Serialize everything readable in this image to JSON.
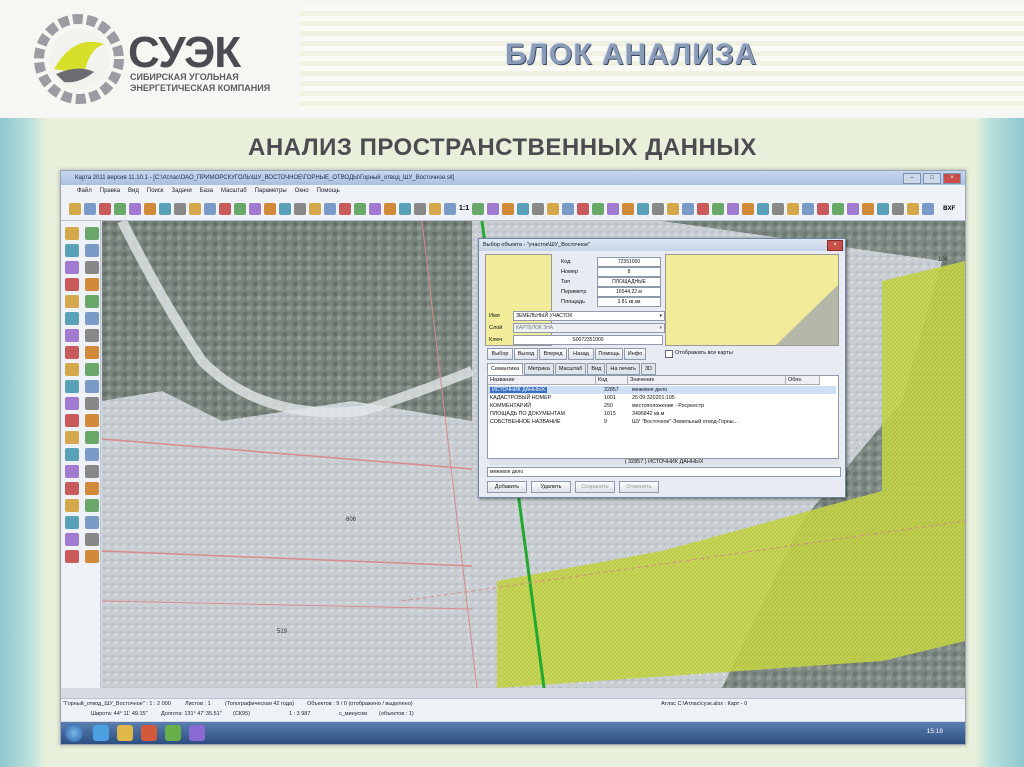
{
  "slide": {
    "logo_title": "СУЭК",
    "logo_subtitle_1": "СИБИРСКАЯ УГОЛЬНАЯ",
    "logo_subtitle_2": "ЭНЕРГЕТИЧЕСКАЯ КОМПАНИЯ",
    "block_title": "БЛОК АНАЛИЗА",
    "section_title": "АНАЛИЗ ПРОСТРАНСТВЕННЫХ ДАННЫХ"
  },
  "app": {
    "window_title": "Карта 2011 версия 11.10.1 - [C:\\Атлас\\ОАО_ПРИМОРСКУГОЛЬ\\ШУ_ВОСТОЧНОЕ\\ГОРНЫЕ_ОТВОДЫ\\Горный_отвод_ШУ_Восточное.sit]",
    "menu": [
      "Файл",
      "Правка",
      "Вид",
      "Поиск",
      "Задачи",
      "База",
      "Масштаб",
      "Параметры",
      "Окно",
      "Помощь"
    ],
    "zoom_label": "1:1",
    "toolbar_right_label": "BXF",
    "map_labels": {
      "label_a": "606",
      "label_b": "519",
      "label_c": "106"
    },
    "status": {
      "map_name": "\"Горный_отвод_ШУ_Восточное\" : 1 : 2 000",
      "sheets": "Листов : 1",
      "topo": "(Топографическая 42 года)",
      "objects": "Объектов : 9 / 0 (отображено / выделено)",
      "atlas": "Атлас C:\\Атлас\\суэк.alsx : Карт - 0",
      "lat": "Широта: 44° 11' 49.15\"",
      "lon": "Долгота: 131° 47' 35.51\"",
      "crs": "(СК95)",
      "scale": "1 : 3 987",
      "layer": "с_минусом",
      "layer_objects": "(объектов : 1)"
    },
    "clock": "15:18"
  },
  "dialog": {
    "title": "Выбор объекта - \"участок\\ШУ_Восточное\"",
    "fields": {
      "code_label": "Код",
      "code_value": "72351000",
      "number_label": "Номер",
      "number_value": "8",
      "type_label": "Тип",
      "type_value": "ПЛОЩАДНЫЕ",
      "perimeter_label": "Периметр",
      "perimeter_value": "16544.22 м",
      "area_label": "Площадь",
      "area_value": "3.81 кв.км"
    },
    "name_label": "Имя",
    "name_value": "ЗЕМЕЛЬНЫЙ УЧАСТОК",
    "layer_label": "Слой",
    "layer_value": "КАРТБЛОК ЗНА",
    "key_label": "Ключ",
    "key_value": "S0072351000",
    "nav_buttons": [
      "Выбор",
      "Выход",
      "Вперед",
      "Назад",
      "Помощь",
      "Инфо"
    ],
    "show_all_label": "Отображать все карты",
    "tabs": [
      "Семантика",
      "Метрика",
      "Масштаб",
      "Вид",
      "На печать",
      "3D"
    ],
    "grid_headers": [
      "Название",
      "Код",
      "Значение",
      "Обяз."
    ],
    "grid_rows": [
      {
        "name": "ИСТОЧНИК ДАННЫХ",
        "code": "32857",
        "value": "межевое дело"
      },
      {
        "name": "КАДАСТРОВЫЙ НОМЕР",
        "code": "1001",
        "value": "25:09:320201:105"
      },
      {
        "name": "КОММЕНТАРИЙ",
        "code": "250",
        "value": "местоположение - Росреестр"
      },
      {
        "name": "ПЛОЩАДЬ ПО ДОКУМЕНТАМ",
        "code": "1015",
        "value": "3496842 кв.м"
      },
      {
        "name": "СОБСТВЕННОЕ НАЗВАНИЕ",
        "code": "9",
        "value": "ШУ \"Восточное\"-Земельный отвод-Горны..."
      }
    ],
    "footer_caption": "( 32857 ) ИСТОЧНИК ДАННЫХ",
    "footer_value": "межевое дело",
    "action_buttons": [
      "Добавить",
      "Удалить",
      "Сохранить",
      "Отменить"
    ]
  }
}
